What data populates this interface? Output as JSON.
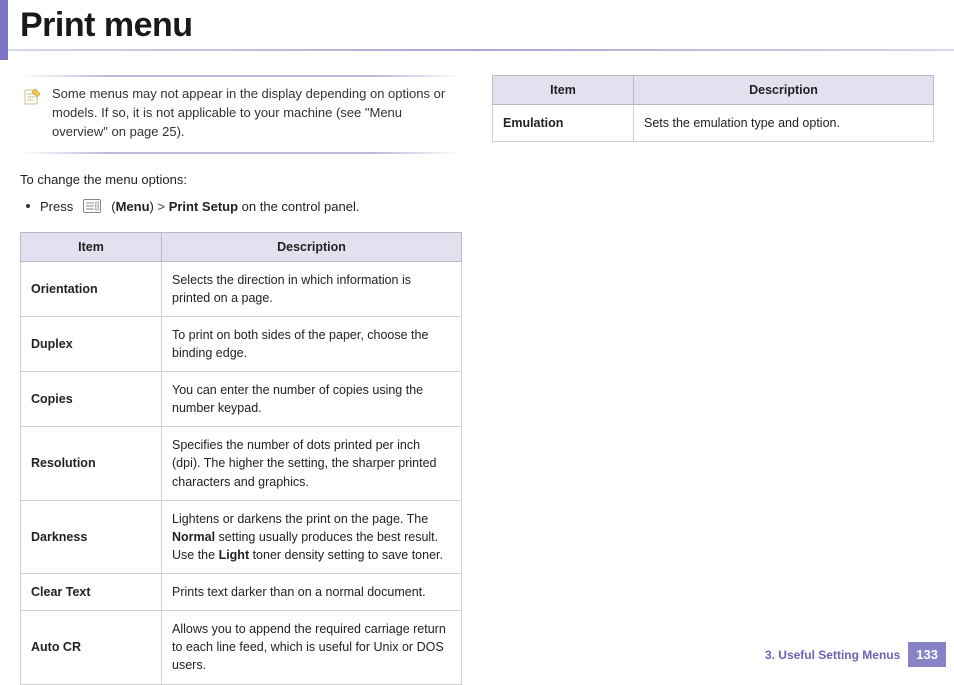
{
  "title": "Print menu",
  "note": "Some menus may not appear in the display depending on options or models. If so, it is not applicable to your machine (see \"Menu overview\" on page 25).",
  "intro": "To change the menu options:",
  "step_press": "Press",
  "step_menu_label": "Menu",
  "step_separator": ">",
  "step_target": "Print Setup",
  "step_tail": "on the control panel.",
  "headers": {
    "item": "Item",
    "desc": "Description"
  },
  "left_table": [
    {
      "item": "Orientation",
      "desc": "Selects the direction in which information is printed on a page."
    },
    {
      "item": "Duplex",
      "desc": "To print on both sides of the paper, choose the binding edge."
    },
    {
      "item": "Copies",
      "desc": "You can enter the number of copies using the number keypad."
    },
    {
      "item": "Resolution",
      "desc": "Specifies the number of dots printed per inch (dpi). The higher the setting, the sharper printed characters and graphics."
    },
    {
      "item": "Darkness",
      "desc_pre": "Lightens or darkens the print on the page. The ",
      "bold1": "Normal",
      "desc_mid": " setting usually produces the best result. Use the ",
      "bold2": "Light",
      "desc_post": " toner density setting to save toner."
    },
    {
      "item": "Clear Text",
      "desc": "Prints text darker than on a normal document."
    },
    {
      "item": "Auto CR",
      "desc": "Allows you to append the required carriage return to each line feed, which is useful for Unix or DOS users."
    }
  ],
  "right_table": [
    {
      "item": "Emulation",
      "desc": "Sets the emulation type and option."
    }
  ],
  "footer": {
    "chapter": "3.  Useful Setting Menus",
    "page": "133"
  }
}
